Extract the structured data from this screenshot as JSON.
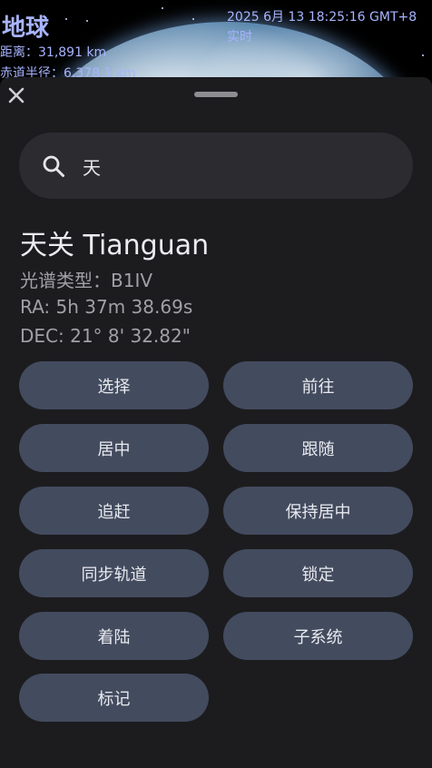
{
  "space_view": {
    "body_name": "地球",
    "distance": "距离：31,891 km",
    "radius": "赤道半径：6,378.1 km",
    "datetime": "2025 6月 13 18:25:16 GMT+8",
    "time_mode": "实时"
  },
  "sheet": {
    "close_icon": "close-icon",
    "search": {
      "value": "天",
      "placeholder": "",
      "icon": "search-icon"
    },
    "object": {
      "title": "天关 Tianguan",
      "spectral_type": "光谱类型：B1IV",
      "ra": "RA: 5h 37m 38.69s",
      "dec": "DEC: 21° 8' 32.82\""
    },
    "actions": [
      {
        "label": "选择"
      },
      {
        "label": "前往"
      },
      {
        "label": "居中"
      },
      {
        "label": "跟随"
      },
      {
        "label": "追赶"
      },
      {
        "label": "保持居中"
      },
      {
        "label": "同步轨道"
      },
      {
        "label": "锁定"
      },
      {
        "label": "着陆"
      },
      {
        "label": "子系统"
      },
      {
        "label": "标记"
      }
    ]
  },
  "colors": {
    "overlay_text": "#a8b4ff",
    "sheet_bg": "#1c1c1f",
    "search_bg": "#2c2c30",
    "button_bg": "#434b5e"
  }
}
